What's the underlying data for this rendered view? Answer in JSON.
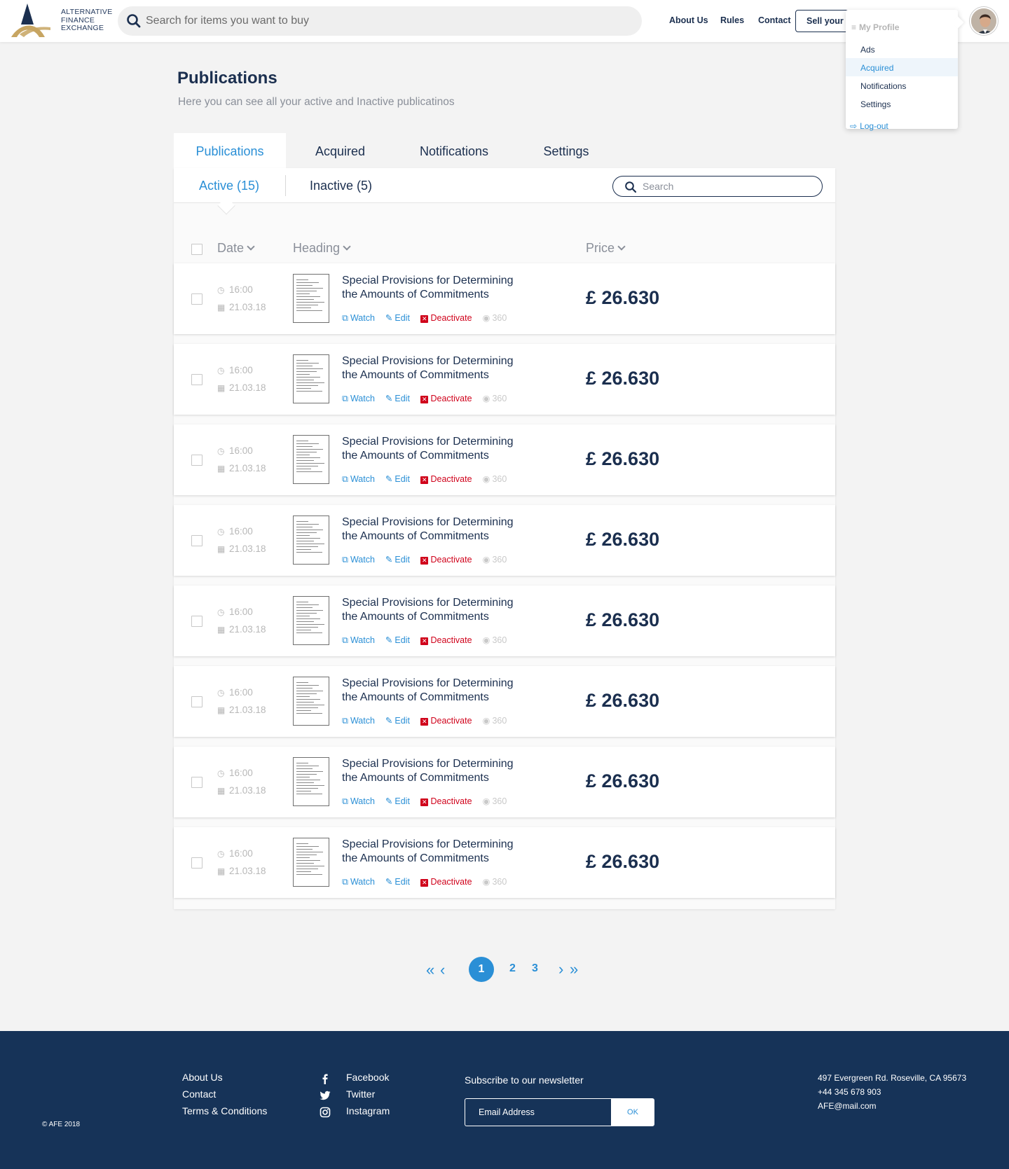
{
  "brand": {
    "name_lines": [
      "ALTERNATIVE",
      "FINANCE",
      "EXCHANGE"
    ],
    "colors": {
      "navy": "#1b2f4f",
      "gold": "#c7a562",
      "accent": "#2a8fd6",
      "danger": "#d0021b",
      "footer": "#163358"
    }
  },
  "header": {
    "search_placeholder": "Search for items you want to buy",
    "nav": {
      "about": "About Us",
      "rules": "Rules",
      "contact": "Contact"
    },
    "sell_label": "Sell your items",
    "avatar_icon": "user-avatar"
  },
  "profile_menu": {
    "header": "My Profile",
    "items": [
      "Ads",
      "Acquired",
      "Notifications",
      "Settings"
    ],
    "active": "Acquired",
    "logout": "Log-out"
  },
  "page": {
    "title": "Publications",
    "subtitle": "Here you can see all your active and Inactive publicatinos"
  },
  "tabs": [
    "Publications",
    "Acquired",
    "Notifications",
    "Settings"
  ],
  "active_tab": "Publications",
  "subtabs": {
    "active": "Active (15)",
    "inactive": "Inactive (5)"
  },
  "panel_search_placeholder": "Search",
  "columns": {
    "date": "Date",
    "heading": "Heading",
    "price": "Price"
  },
  "rows": [
    {
      "time": "16:00",
      "date": "21.03.18",
      "title": "Special Provisions for Determining the Amounts of Commitments",
      "price": "£ 26.630",
      "views": "360"
    },
    {
      "time": "16:00",
      "date": "21.03.18",
      "title": "Special Provisions for Determining the Amounts of Commitments",
      "price": "£ 26.630",
      "views": "360"
    },
    {
      "time": "16:00",
      "date": "21.03.18",
      "title": "Special Provisions for Determining the Amounts of Commitments",
      "price": "£ 26.630",
      "views": "360"
    },
    {
      "time": "16:00",
      "date": "21.03.18",
      "title": "Special Provisions for Determining the Amounts of Commitments",
      "price": "£ 26.630",
      "views": "360"
    },
    {
      "time": "16:00",
      "date": "21.03.18",
      "title": "Special Provisions for Determining the Amounts of Commitments",
      "price": "£ 26.630",
      "views": "360"
    },
    {
      "time": "16:00",
      "date": "21.03.18",
      "title": "Special Provisions for Determining the Amounts of Commitments",
      "price": "£ 26.630",
      "views": "360"
    },
    {
      "time": "16:00",
      "date": "21.03.18",
      "title": "Special Provisions for Determining the Amounts of Commitments",
      "price": "£ 26.630",
      "views": "360"
    },
    {
      "time": "16:00",
      "date": "21.03.18",
      "title": "Special Provisions for Determining the Amounts of Commitments",
      "price": "£ 26.630",
      "views": "360"
    }
  ],
  "row_actions": {
    "watch": "Watch",
    "edit": "Edit",
    "deactivate": "Deactivate"
  },
  "pagination": {
    "pages": [
      "1",
      "2",
      "3"
    ],
    "current": "1"
  },
  "footer": {
    "links": [
      "About Us",
      "Contact",
      "Terms & Conditions"
    ],
    "social": [
      {
        "label": "Facebook",
        "icon": "facebook-icon"
      },
      {
        "label": "Twitter",
        "icon": "twitter-icon"
      },
      {
        "label": "Instagram",
        "icon": "instagram-icon"
      }
    ],
    "newsletter_title": "Subscribe to our newsletter",
    "email_placeholder": "Email Address",
    "ok_label": "OK",
    "address": "497 Evergreen Rd. Roseville, CA 95673",
    "phone": "+44 345 678 903",
    "email": "AFE@mail.com",
    "copyright": "© AFE 2018"
  }
}
